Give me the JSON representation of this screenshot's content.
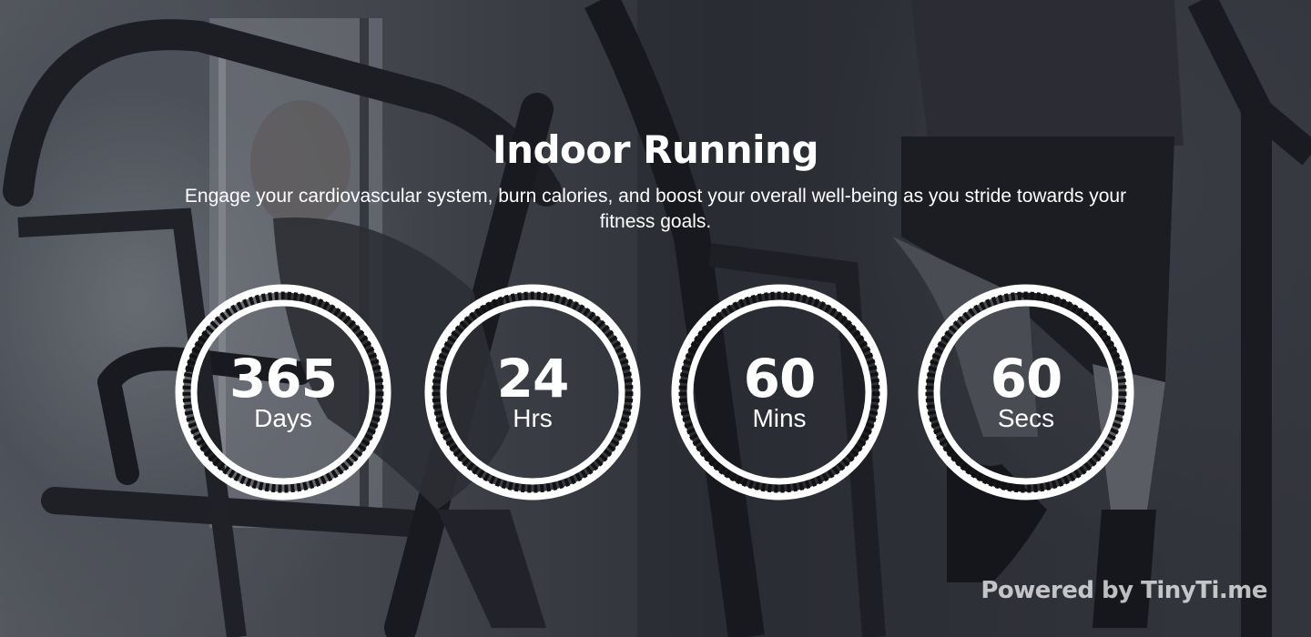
{
  "page": {
    "title": "Indoor Running",
    "description": "Engage your cardiovascular system, burn calories, and boost your overall well-being as you stride towards your fitness goals."
  },
  "countdown": {
    "days": {
      "value": "365",
      "label": "Days"
    },
    "hours": {
      "value": "24",
      "label": "Hrs"
    },
    "minutes": {
      "value": "60",
      "label": "Mins"
    },
    "seconds": {
      "value": "60",
      "label": "Secs"
    }
  },
  "footer": {
    "powered_by": "Powered by TinyTi.me"
  },
  "colors": {
    "text": "#ffffff",
    "ring": "#ffffff",
    "ring_pattern": "#111111",
    "overlay": "#1a1c22"
  },
  "background": {
    "description_icon": "treadmill-photo"
  }
}
